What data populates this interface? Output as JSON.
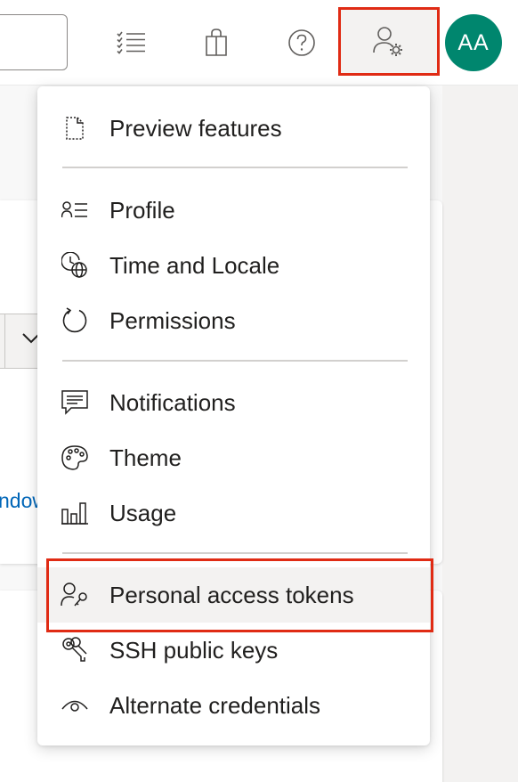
{
  "topbar": {
    "icons": [
      {
        "name": "work-items-icon"
      },
      {
        "name": "marketplace-icon"
      },
      {
        "name": "help-icon"
      },
      {
        "name": "user-settings-icon"
      }
    ],
    "avatar_initials": "AA",
    "avatar_color": "#00866e",
    "highlight_color": "#e02b14"
  },
  "background": {
    "partial_link_text": "ndow"
  },
  "menu": {
    "items": [
      {
        "label": "Preview features",
        "icon": "preview-features-icon"
      },
      {
        "label": "Profile",
        "icon": "profile-icon"
      },
      {
        "label": "Time and Locale",
        "icon": "time-locale-icon"
      },
      {
        "label": "Permissions",
        "icon": "permissions-icon"
      },
      {
        "label": "Notifications",
        "icon": "notifications-icon"
      },
      {
        "label": "Theme",
        "icon": "theme-icon"
      },
      {
        "label": "Usage",
        "icon": "usage-icon"
      },
      {
        "label": "Personal access tokens",
        "icon": "personal-access-tokens-icon"
      },
      {
        "label": "SSH public keys",
        "icon": "ssh-keys-icon"
      },
      {
        "label": "Alternate credentials",
        "icon": "alternate-credentials-icon"
      }
    ]
  }
}
